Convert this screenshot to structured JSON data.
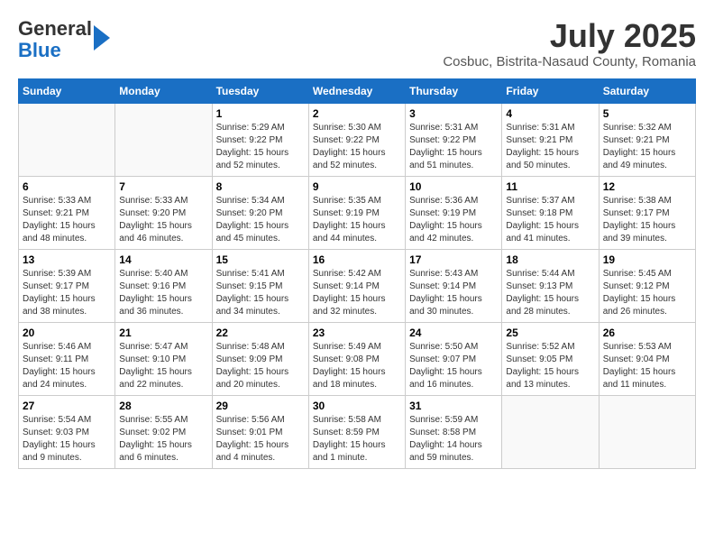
{
  "header": {
    "logo_line1": "General",
    "logo_line2": "Blue",
    "month_title": "July 2025",
    "subtitle": "Cosbuc, Bistrita-Nasaud County, Romania"
  },
  "days_of_week": [
    "Sunday",
    "Monday",
    "Tuesday",
    "Wednesday",
    "Thursday",
    "Friday",
    "Saturday"
  ],
  "weeks": [
    [
      {
        "day": "",
        "info": ""
      },
      {
        "day": "",
        "info": ""
      },
      {
        "day": "1",
        "info": "Sunrise: 5:29 AM\nSunset: 9:22 PM\nDaylight: 15 hours and 52 minutes."
      },
      {
        "day": "2",
        "info": "Sunrise: 5:30 AM\nSunset: 9:22 PM\nDaylight: 15 hours and 52 minutes."
      },
      {
        "day": "3",
        "info": "Sunrise: 5:31 AM\nSunset: 9:22 PM\nDaylight: 15 hours and 51 minutes."
      },
      {
        "day": "4",
        "info": "Sunrise: 5:31 AM\nSunset: 9:21 PM\nDaylight: 15 hours and 50 minutes."
      },
      {
        "day": "5",
        "info": "Sunrise: 5:32 AM\nSunset: 9:21 PM\nDaylight: 15 hours and 49 minutes."
      }
    ],
    [
      {
        "day": "6",
        "info": "Sunrise: 5:33 AM\nSunset: 9:21 PM\nDaylight: 15 hours and 48 minutes."
      },
      {
        "day": "7",
        "info": "Sunrise: 5:33 AM\nSunset: 9:20 PM\nDaylight: 15 hours and 46 minutes."
      },
      {
        "day": "8",
        "info": "Sunrise: 5:34 AM\nSunset: 9:20 PM\nDaylight: 15 hours and 45 minutes."
      },
      {
        "day": "9",
        "info": "Sunrise: 5:35 AM\nSunset: 9:19 PM\nDaylight: 15 hours and 44 minutes."
      },
      {
        "day": "10",
        "info": "Sunrise: 5:36 AM\nSunset: 9:19 PM\nDaylight: 15 hours and 42 minutes."
      },
      {
        "day": "11",
        "info": "Sunrise: 5:37 AM\nSunset: 9:18 PM\nDaylight: 15 hours and 41 minutes."
      },
      {
        "day": "12",
        "info": "Sunrise: 5:38 AM\nSunset: 9:17 PM\nDaylight: 15 hours and 39 minutes."
      }
    ],
    [
      {
        "day": "13",
        "info": "Sunrise: 5:39 AM\nSunset: 9:17 PM\nDaylight: 15 hours and 38 minutes."
      },
      {
        "day": "14",
        "info": "Sunrise: 5:40 AM\nSunset: 9:16 PM\nDaylight: 15 hours and 36 minutes."
      },
      {
        "day": "15",
        "info": "Sunrise: 5:41 AM\nSunset: 9:15 PM\nDaylight: 15 hours and 34 minutes."
      },
      {
        "day": "16",
        "info": "Sunrise: 5:42 AM\nSunset: 9:14 PM\nDaylight: 15 hours and 32 minutes."
      },
      {
        "day": "17",
        "info": "Sunrise: 5:43 AM\nSunset: 9:14 PM\nDaylight: 15 hours and 30 minutes."
      },
      {
        "day": "18",
        "info": "Sunrise: 5:44 AM\nSunset: 9:13 PM\nDaylight: 15 hours and 28 minutes."
      },
      {
        "day": "19",
        "info": "Sunrise: 5:45 AM\nSunset: 9:12 PM\nDaylight: 15 hours and 26 minutes."
      }
    ],
    [
      {
        "day": "20",
        "info": "Sunrise: 5:46 AM\nSunset: 9:11 PM\nDaylight: 15 hours and 24 minutes."
      },
      {
        "day": "21",
        "info": "Sunrise: 5:47 AM\nSunset: 9:10 PM\nDaylight: 15 hours and 22 minutes."
      },
      {
        "day": "22",
        "info": "Sunrise: 5:48 AM\nSunset: 9:09 PM\nDaylight: 15 hours and 20 minutes."
      },
      {
        "day": "23",
        "info": "Sunrise: 5:49 AM\nSunset: 9:08 PM\nDaylight: 15 hours and 18 minutes."
      },
      {
        "day": "24",
        "info": "Sunrise: 5:50 AM\nSunset: 9:07 PM\nDaylight: 15 hours and 16 minutes."
      },
      {
        "day": "25",
        "info": "Sunrise: 5:52 AM\nSunset: 9:05 PM\nDaylight: 15 hours and 13 minutes."
      },
      {
        "day": "26",
        "info": "Sunrise: 5:53 AM\nSunset: 9:04 PM\nDaylight: 15 hours and 11 minutes."
      }
    ],
    [
      {
        "day": "27",
        "info": "Sunrise: 5:54 AM\nSunset: 9:03 PM\nDaylight: 15 hours and 9 minutes."
      },
      {
        "day": "28",
        "info": "Sunrise: 5:55 AM\nSunset: 9:02 PM\nDaylight: 15 hours and 6 minutes."
      },
      {
        "day": "29",
        "info": "Sunrise: 5:56 AM\nSunset: 9:01 PM\nDaylight: 15 hours and 4 minutes."
      },
      {
        "day": "30",
        "info": "Sunrise: 5:58 AM\nSunset: 8:59 PM\nDaylight: 15 hours and 1 minute."
      },
      {
        "day": "31",
        "info": "Sunrise: 5:59 AM\nSunset: 8:58 PM\nDaylight: 14 hours and 59 minutes."
      },
      {
        "day": "",
        "info": ""
      },
      {
        "day": "",
        "info": ""
      }
    ]
  ]
}
